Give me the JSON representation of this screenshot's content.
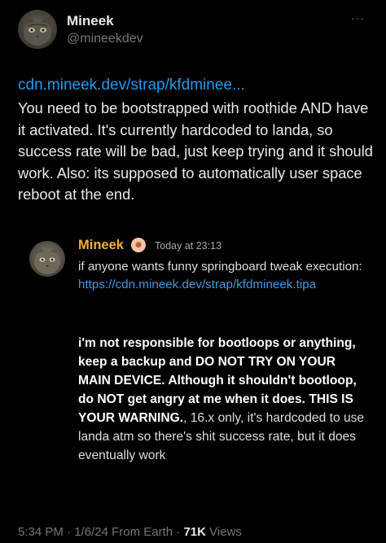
{
  "author": {
    "name": "Mineek",
    "handle": "@mineekdev",
    "more_glyph": "···"
  },
  "tweet": {
    "link": "cdn.mineek.dev/strap/kfdminee...",
    "text": "You need to be bootstrapped with roothide AND have it activated. It's currently hardcoded to landa, so success rate will be bad, just keep trying and it should work. Also: its supposed to automatically user space reboot at the end."
  },
  "embed": {
    "author": "Mineek",
    "badge_icon": "sun-badge-icon",
    "timestamp": "Today at 23:13",
    "body_prefix": "if anyone wants funny springboard tweak execution: ",
    "body_link": "https://cdn.mineek.dev/strap/kfdmineek.tipa",
    "warning_bold_1": "i'm not responsible for bootloops or anything, keep a backup and DO NOT TRY ON YOUR MAIN DEVICE. Although it shouldn't bootloop, do NOT get angry at me when it does. THIS IS YOUR WARNING.",
    "warning_rest": ", 16.x only, it's hardcoded to use landa atm so there's shit success rate, but it does eventually work"
  },
  "footer": {
    "time": "5:34 PM",
    "date": "1/6/24",
    "location": "From Earth",
    "views_count": "71K",
    "views_label": "Views",
    "separator": "·"
  },
  "colors": {
    "background": "#000000",
    "link": "#1d9bf0",
    "embed_author": "#f0b232",
    "secondary_text": "#71767b"
  }
}
